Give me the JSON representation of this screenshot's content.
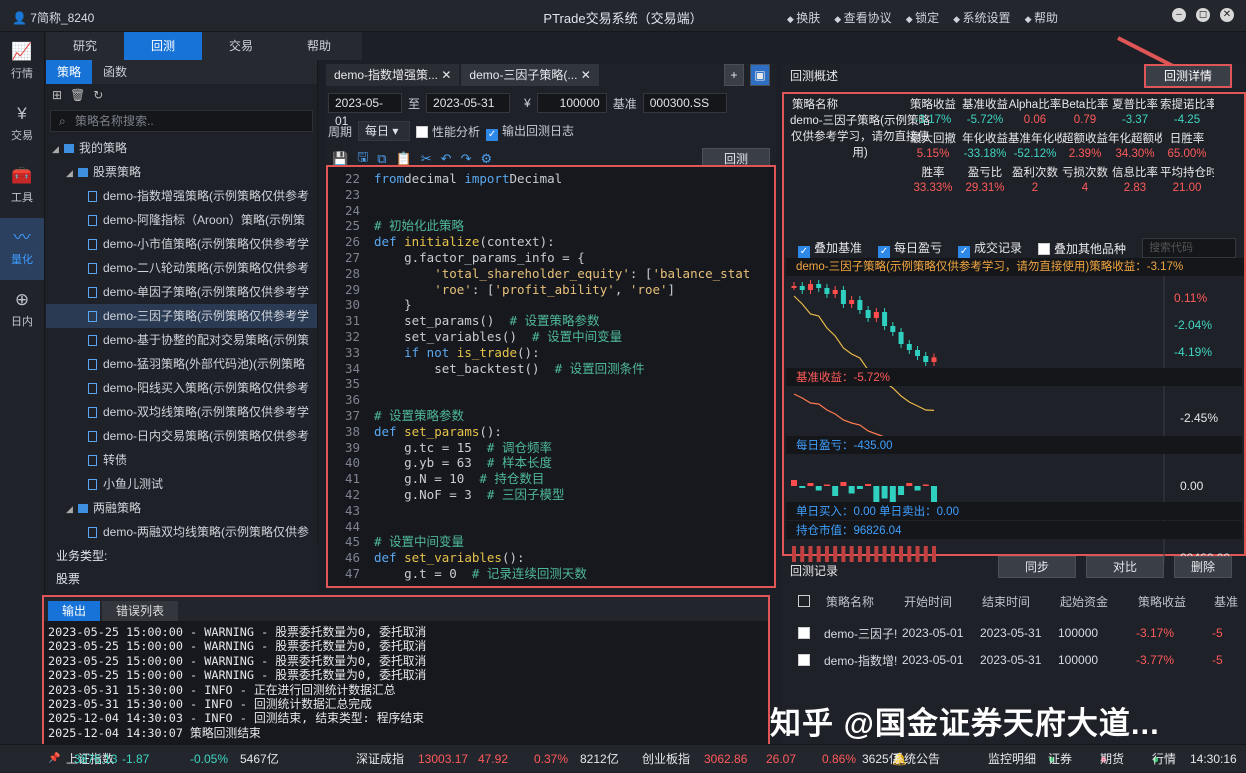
{
  "window": {
    "user": "7简称_8240",
    "title": "PTrade交易系统（交易端）",
    "buttons": [
      "换肤",
      "查看协议",
      "锁定",
      "系统设置",
      "帮助"
    ]
  },
  "leftnav": [
    {
      "label": "行情",
      "icon": "chart-icon"
    },
    {
      "label": "交易",
      "icon": "yen-icon"
    },
    {
      "label": "工具",
      "icon": "toolbox-icon"
    },
    {
      "label": "量化",
      "icon": "quant-icon"
    },
    {
      "label": "日内",
      "icon": "intraday-icon"
    }
  ],
  "topmenu": [
    "研究",
    "回测",
    "交易",
    "帮助"
  ],
  "sidebar": {
    "tabs": [
      "策略",
      "函数"
    ],
    "search_placeholder": "策略名称搜索..",
    "tree": [
      {
        "label": "我的策略",
        "level": 0,
        "type": "folder"
      },
      {
        "label": "股票策略",
        "level": 1,
        "type": "folder"
      },
      {
        "label": "demo-指数增强策略(示例策略仅供参考",
        "level": 2,
        "type": "file"
      },
      {
        "label": "demo-阿隆指标（Aroon）策略(示例策",
        "level": 2,
        "type": "file"
      },
      {
        "label": "demo-小市值策略(示例策略仅供参考学",
        "level": 2,
        "type": "file"
      },
      {
        "label": "demo-二八轮动策略(示例策略仅供参考",
        "level": 2,
        "type": "file"
      },
      {
        "label": "demo-单因子策略(示例策略仅供参考学",
        "level": 2,
        "type": "file"
      },
      {
        "label": "demo-三因子策略(示例策略仅供参考学",
        "level": 2,
        "type": "file",
        "selected": true
      },
      {
        "label": "demo-基于协整的配对交易策略(示例策",
        "level": 2,
        "type": "file"
      },
      {
        "label": "demo-猛羽策略(外部代码池)(示例策略",
        "level": 2,
        "type": "file"
      },
      {
        "label": "demo-阳线买入策略(示例策略仅供参考",
        "level": 2,
        "type": "file"
      },
      {
        "label": "demo-双均线策略(示例策略仅供参考学",
        "level": 2,
        "type": "file"
      },
      {
        "label": "demo-日内交易策略(示例策略仅供参考",
        "level": 2,
        "type": "file"
      },
      {
        "label": "转债",
        "level": 2,
        "type": "file"
      },
      {
        "label": "小鱼儿测试",
        "level": 2,
        "type": "file"
      },
      {
        "label": "两融策略",
        "level": 1,
        "type": "folder"
      },
      {
        "label": "demo-两融双均线策略(示例策略仅供参",
        "level": 2,
        "type": "file"
      }
    ],
    "biz_label": "业务类型:",
    "biz_value": "股票"
  },
  "editor": {
    "tabs": [
      "demo-指数增强策...",
      "demo-三因子策略(..."
    ],
    "start_date": "2023-05-01",
    "to": "至",
    "end_date": "2023-05-31",
    "currency": "¥",
    "capital": "100000",
    "benchmark_label": "基准",
    "benchmark": "000300.SS",
    "period_label": "周期",
    "period": "每日",
    "perf_label": "性能分析",
    "log_label": "输出回测日志",
    "run_button": "回测",
    "code": [
      {
        "n": "22",
        "t": [
          [
            "kw",
            "from"
          ],
          [
            "",
            "decimal "
          ],
          [
            "kw",
            "import"
          ],
          [
            "",
            "Decimal"
          ]
        ]
      },
      {
        "n": "23",
        "t": []
      },
      {
        "n": "24",
        "t": []
      },
      {
        "n": "25",
        "t": [
          [
            "cm",
            "# 初始化此策略"
          ]
        ]
      },
      {
        "n": "26",
        "t": [
          [
            "kw",
            "def "
          ],
          [
            "fn",
            "initialize"
          ],
          [
            "",
            "(context):"
          ]
        ]
      },
      {
        "n": "27",
        "t": [
          [
            "",
            "    g.factor_params_info = {"
          ]
        ]
      },
      {
        "n": "28",
        "t": [
          [
            "st",
            "        'total_shareholder_equity'"
          ],
          [
            "",
            ": ["
          ],
          [
            "st",
            "'balance_stat"
          ]
        ]
      },
      {
        "n": "29",
        "t": [
          [
            "st",
            "        'roe'"
          ],
          [
            "",
            ": ["
          ],
          [
            "st",
            "'profit_ability'"
          ],
          [
            "",
            ", "
          ],
          [
            "st",
            "'roe'"
          ],
          [
            "",
            "]"
          ]
        ]
      },
      {
        "n": "30",
        "t": [
          [
            "",
            "    }"
          ]
        ]
      },
      {
        "n": "31",
        "t": [
          [
            "",
            "    set_params()  "
          ],
          [
            "cm",
            "# 设置策略参数"
          ]
        ]
      },
      {
        "n": "32",
        "t": [
          [
            "",
            "    set_variables()  "
          ],
          [
            "cm",
            "# 设置中间变量"
          ]
        ]
      },
      {
        "n": "33",
        "t": [
          [
            "kw",
            "    if not "
          ],
          [
            "fn",
            "is_trade"
          ],
          [
            "",
            "():"
          ]
        ]
      },
      {
        "n": "34",
        "t": [
          [
            "",
            "        set_backtest()  "
          ],
          [
            "cm",
            "# 设置回测条件"
          ]
        ]
      },
      {
        "n": "35",
        "t": []
      },
      {
        "n": "36",
        "t": []
      },
      {
        "n": "37",
        "t": [
          [
            "cm",
            "# 设置策略参数"
          ]
        ]
      },
      {
        "n": "38",
        "t": [
          [
            "kw",
            "def "
          ],
          [
            "fn",
            "set_params"
          ],
          [
            "",
            "():"
          ]
        ]
      },
      {
        "n": "39",
        "t": [
          [
            "",
            "    g.tc = 15  "
          ],
          [
            "cm",
            "# 调仓频率"
          ]
        ]
      },
      {
        "n": "40",
        "t": [
          [
            "",
            "    g.yb = 63  "
          ],
          [
            "cm",
            "# 样本长度"
          ]
        ]
      },
      {
        "n": "41",
        "t": [
          [
            "",
            "    g.N = 10  "
          ],
          [
            "cm",
            "# 持仓数目"
          ]
        ]
      },
      {
        "n": "42",
        "t": [
          [
            "",
            "    g.NoF = 3  "
          ],
          [
            "cm",
            "# 三因子模型"
          ]
        ]
      },
      {
        "n": "43",
        "t": []
      },
      {
        "n": "44",
        "t": []
      },
      {
        "n": "45",
        "t": [
          [
            "cm",
            "# 设置中间变量"
          ]
        ]
      },
      {
        "n": "46",
        "t": [
          [
            "kw",
            "def "
          ],
          [
            "fn",
            "set_variables"
          ],
          [
            "",
            "():"
          ]
        ]
      },
      {
        "n": "47",
        "t": [
          [
            "",
            "    g.t = 0  "
          ],
          [
            "cm",
            "# 记录连续回测天数"
          ]
        ]
      }
    ]
  },
  "output": {
    "tabs": [
      "输出",
      "错误列表"
    ],
    "lines": [
      "2023-05-25 15:00:00 - WARNING - 股票委托数量为0, 委托取消",
      "2023-05-25 15:00:00 - WARNING - 股票委托数量为0, 委托取消",
      "2023-05-25 15:00:00 - WARNING - 股票委托数量为0, 委托取消",
      "2023-05-25 15:00:00 - WARNING - 股票委托数量为0, 委托取消",
      "2023-05-31 15:30:00 - INFO - 正在进行回测统计数据汇总",
      "2023-05-31 15:30:00 - INFO - 回测统计数据汇总完成",
      "2025-12-04 14:30:03 - INFO - 回测结束, 结束类型: 程序结束",
      "2025-12-04 14:30:07 策略回测结束"
    ]
  },
  "overview": {
    "title": "回测概述",
    "detail_button": "回测详情",
    "strategy_label": "策略名称",
    "strategy_name": "demo-三因子策略(示例策略仅供参考学习，请勿直接使用)",
    "metrics_row1": [
      [
        "策略收益",
        "-3.17%"
      ],
      [
        "基准收益",
        "-5.72%"
      ],
      [
        "Alpha比率",
        "0.06"
      ],
      [
        "Beta比率",
        "0.79"
      ],
      [
        "夏普比率",
        "-3.37"
      ],
      [
        "索提诺比率",
        "-4.25"
      ]
    ],
    "metrics_row2": [
      [
        "最大回撤",
        "5.15%"
      ],
      [
        "年化收益",
        "-33.18%"
      ],
      [
        "基准年化收益",
        "-52.12%"
      ],
      [
        "超额收益",
        "2.39%"
      ],
      [
        "年化超额收益",
        "34.30%"
      ],
      [
        "日胜率",
        "65.00%"
      ]
    ],
    "metrics_row3": [
      [
        "胜率",
        "33.33%"
      ],
      [
        "盈亏比",
        "29.31%"
      ],
      [
        "盈利次数",
        "2"
      ],
      [
        "亏损次数",
        "4"
      ],
      [
        "信息比率",
        "2.83"
      ],
      [
        "平均持仓时间",
        "21.00"
      ]
    ],
    "checks": [
      "叠加基准",
      "每日盈亏",
      "成交记录",
      "叠加其他品种"
    ],
    "search_placeholder": "搜索代码",
    "chart_title": "demo-三因子策略(示例策略仅供参考学习，请勿直接使用)策略收益：-3.17%",
    "chart_ticks": [
      "0.11%",
      "-2.04%",
      "-4.19%"
    ],
    "bench_label": "基准收益：-5.72%",
    "bench_tick": "-2.45%",
    "daily_label": "每日盈亏：-435.00",
    "daily_tick": "0.00",
    "buysell": "单日买入：0.00  单日卖出：0.00",
    "holding": "持仓市值：96826.04",
    "holding_tick": "99460.00"
  },
  "chart_data": {
    "type": "line",
    "title": "demo-三因子策略(示例策略仅供参考学习，请勿直接使用)策略收益：-3.17%",
    "series": [
      {
        "name": "策略收益",
        "values": [
          0.4,
          0.2,
          0.5,
          0.3,
          0.0,
          0.2,
          -0.5,
          -0.3,
          -0.8,
          -1.2,
          -0.9,
          -1.6,
          -1.9,
          -2.5,
          -2.8,
          -3.1,
          -3.4,
          -3.17
        ]
      },
      {
        "name": "基准收益",
        "values": [
          0.0,
          -0.4,
          -0.9,
          -1.0,
          -1.6,
          -2.0,
          -2.6,
          -2.9,
          -3.1,
          -3.7,
          -4.0,
          -4.3,
          -4.6,
          -5.0,
          -5.3,
          -5.5,
          -5.7,
          -5.72
        ]
      }
    ],
    "daily_pnl": [
      120,
      -40,
      60,
      -90,
      30,
      -200,
      80,
      -150,
      -60,
      40,
      -320,
      -250,
      -420,
      -180,
      60,
      -90,
      30,
      -435
    ],
    "ylim": [
      -4.19,
      0.11
    ]
  },
  "records": {
    "title": "回测记录",
    "buttons": [
      "同步",
      "对比",
      "删除"
    ],
    "headers": [
      "策略名称",
      "开始时间",
      "结束时间",
      "起始资金",
      "策略收益",
      "基准"
    ],
    "rows": [
      [
        "demo-三因子!",
        "2023-05-01",
        "2023-05-31",
        "100000",
        "-3.17%",
        "-5"
      ],
      [
        "demo-指数增!",
        "2023-05-01",
        "2023-05-31",
        "100000",
        "-3.77%",
        "-5"
      ]
    ]
  },
  "statusbar": {
    "items": [
      {
        "name": "上证指数",
        "val": "3876.13",
        "chg": "-1.87",
        "pct": "-0.05%",
        "amt": "5467亿"
      },
      {
        "name": "深证成指",
        "val": "13003.17",
        "chg": "47.92",
        "pct": "0.37%",
        "amt": "8212亿"
      },
      {
        "name": "创业板指",
        "val": "3062.86",
        "chg": "26.07",
        "pct": "0.86%",
        "amt": "3625亿"
      }
    ],
    "notice": "系统公告",
    "monitor": "监控明细",
    "links": [
      "证券",
      "期货",
      "行情"
    ],
    "time": "14:30:16"
  },
  "watermark": "知乎 @国金证券天府大道..."
}
